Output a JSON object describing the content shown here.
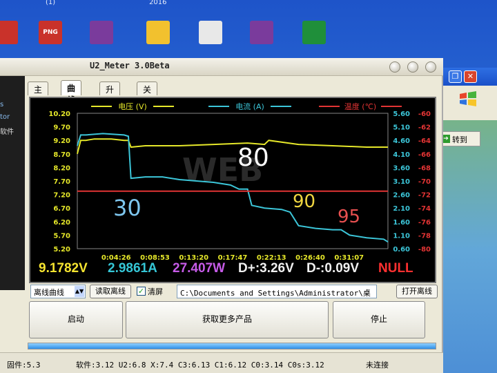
{
  "desktop": {
    "top_labels": [
      "(1)",
      "2016"
    ],
    "icons": [
      {
        "caption": "",
        "color": "#c9322a"
      },
      {
        "caption": "PNG",
        "color": "#c9322a"
      },
      {
        "caption": "",
        "color": "#7a3b9c"
      },
      {
        "caption": "",
        "color": "#f2c12e"
      },
      {
        "caption": "",
        "color": "#e8e8e8"
      },
      {
        "caption": "",
        "color": "#7a3b9c"
      },
      {
        "caption": "",
        "color": "#1f8f3a"
      }
    ]
  },
  "right_window": {
    "close_label": "✕",
    "goto_label": "转到"
  },
  "app": {
    "title": "U2_Meter 3.0Beta",
    "left_strip": [
      "s",
      "tor",
      "软件"
    ],
    "tabs": [
      {
        "label": "主页",
        "active": false
      },
      {
        "label": "曲线",
        "active": true
      },
      {
        "label": "升级",
        "active": false
      },
      {
        "label": "关于",
        "active": false
      }
    ],
    "readouts": {
      "voltage": {
        "text": "9.1782V",
        "color": "#f5e430"
      },
      "current": {
        "text": "2.9861A",
        "color": "#35c6d6"
      },
      "power": {
        "text": "27.407W",
        "color": "#c65be8"
      },
      "dplus": {
        "text": "D+:3.26V",
        "color": "#f0f0f0"
      },
      "dminus": {
        "text": "D-:0.09V",
        "color": "#f0f0f0"
      },
      "null": {
        "text": "NULL",
        "color": "#ff3030"
      }
    },
    "controls": {
      "curve_select": "离线曲线",
      "read_button": "读取离线",
      "clear_label": "清屏",
      "clear_checked": true,
      "path": "C:\\Documents and Settings\\Administrator\\桌",
      "open_button": "打开离线"
    },
    "buttons": {
      "start": "启动",
      "more": "获取更多产品",
      "stop": "停止"
    },
    "progress": 1.0,
    "status": {
      "firmware": "固件:5.3",
      "versions": "软件:3.12 U2:6.8 X:7.4 C3:6.13 C1:6.12 C0:3.14 C0s:3.12",
      "connection": "未连接"
    }
  },
  "chart_data": {
    "type": "line",
    "legend": [
      "电压 (V)",
      "电流 (A)",
      "温度 (℃)"
    ],
    "colors": {
      "voltage": "#e6e82a",
      "current": "#3cc6d9",
      "temperature": "#e23434"
    },
    "x_ticks": [
      "0:04:26",
      "0:08:53",
      "0:13:20",
      "0:17:47",
      "0:22:13",
      "0:26:40",
      "0:31:07"
    ],
    "y_left_ticks": [
      "10.20",
      "9.70",
      "9.20",
      "8.70",
      "8.20",
      "7.70",
      "7.20",
      "6.70",
      "6.20",
      "5.70",
      "5.20"
    ],
    "y_left_range": [
      5.2,
      10.2
    ],
    "y_right1_ticks": [
      "5.60",
      "5.10",
      "4.60",
      "4.10",
      "3.60",
      "3.10",
      "2.60",
      "2.10",
      "1.60",
      "1.10",
      "0.60"
    ],
    "y_right1_range": [
      0.6,
      5.6
    ],
    "y_right2_ticks": [
      "-60",
      "-62",
      "-64",
      "-66",
      "-68",
      "-70",
      "-72",
      "-74",
      "-76",
      "-78",
      "-80"
    ],
    "y_right2_range": [
      -80,
      -60
    ],
    "series": [
      {
        "name": "电压 (V)",
        "axis": "left",
        "x": [
          0,
          0.4,
          1,
          2,
          4,
          5.5,
          6,
          6.3,
          8,
          12,
          16,
          20,
          22,
          22.5,
          26,
          30,
          34,
          36.5
        ],
        "y": [
          8.7,
          9.2,
          9.2,
          9.25,
          9.25,
          9.2,
          9.2,
          8.95,
          9.0,
          9.0,
          9.05,
          9.1,
          9.05,
          9.2,
          9.05,
          9.0,
          8.95,
          8.95
        ]
      },
      {
        "name": "电流 (A)",
        "axis": "right1",
        "x": [
          0,
          0.4,
          1,
          3,
          5.5,
          6,
          6.3,
          8,
          10,
          12,
          14,
          16,
          18,
          19,
          20,
          20.5,
          22,
          24,
          25,
          26,
          28,
          30,
          31,
          32,
          34,
          36,
          36.5
        ],
        "y": [
          4.4,
          4.8,
          4.8,
          4.85,
          4.8,
          4.75,
          3.2,
          3.25,
          3.25,
          3.15,
          3.1,
          3.05,
          2.95,
          2.8,
          2.8,
          2.2,
          2.1,
          2.05,
          1.95,
          1.45,
          1.35,
          1.3,
          1.3,
          1.1,
          1.0,
          0.95,
          0.85
        ]
      },
      {
        "name": "温度 (℃)",
        "axis": "right2",
        "x": [
          0,
          36.5
        ],
        "y": [
          -71.5,
          -71.5
        ]
      }
    ],
    "annotations": [
      {
        "text": "30",
        "color": "#7ec6ee"
      },
      {
        "text": "80",
        "color": "#ffffff"
      },
      {
        "text": "90",
        "color": "#f0d640"
      },
      {
        "text": "95",
        "color": "#e85050"
      }
    ]
  }
}
